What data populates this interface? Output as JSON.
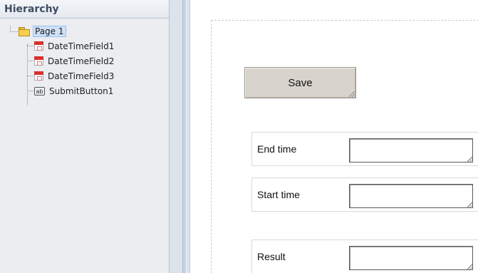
{
  "hierarchy": {
    "title": "Hierarchy",
    "root": {
      "label": "Page 1",
      "icon": "folder-icon"
    },
    "children": [
      {
        "label": "DateTimeField1",
        "icon": "calendar-icon"
      },
      {
        "label": "DateTimeField2",
        "icon": "calendar-icon"
      },
      {
        "label": "DateTimeField3",
        "icon": "calendar-icon"
      },
      {
        "label": "SubmitButton1",
        "icon": "text-ab-icon",
        "icon_text": "ab"
      }
    ]
  },
  "canvas": {
    "save_button": {
      "label": "Save"
    },
    "fields": [
      {
        "label": "End time",
        "value": ""
      },
      {
        "label": "Start time",
        "value": ""
      },
      {
        "label": "Result",
        "value": ""
      }
    ]
  },
  "colors": {
    "panel_bg": "#ebedf1",
    "header_text": "#3e4d63",
    "selection_bg": "#cfe0f7",
    "button_bg": "#d8d4cc",
    "calendar_red": "#d9322b",
    "folder_yellow": "#f6cf52"
  }
}
